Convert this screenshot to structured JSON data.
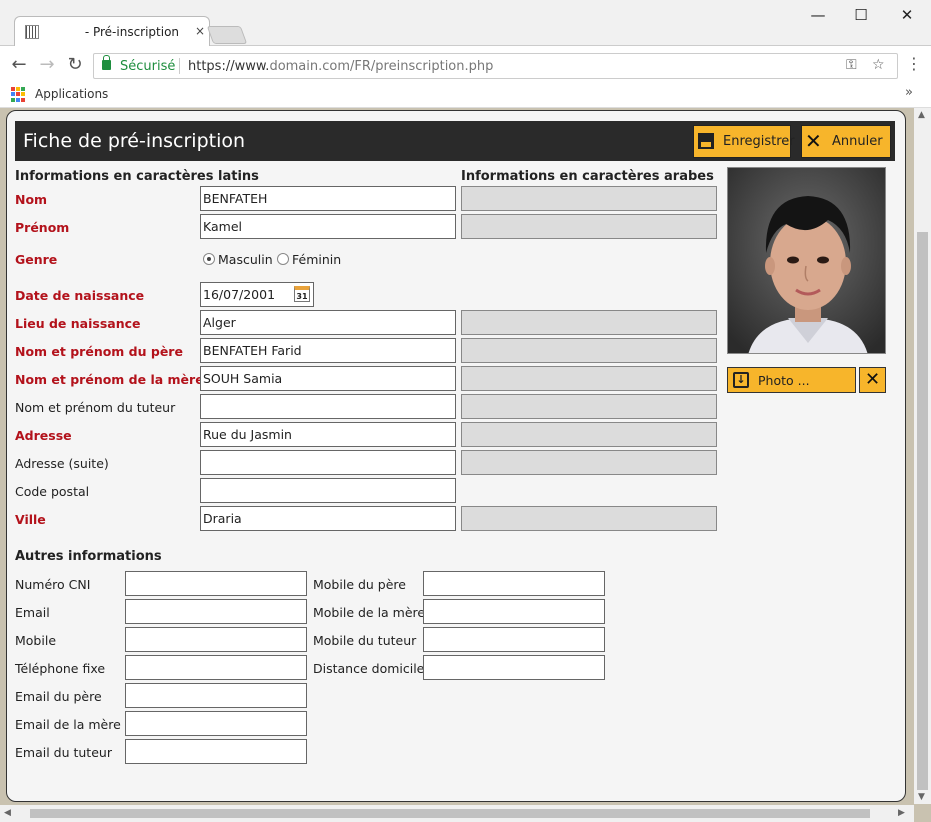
{
  "browser": {
    "tab_title": "Pré-inscription",
    "tab_title_prefix": "    - ",
    "tab_close": "×",
    "win_min": "—",
    "win_max": "☐",
    "win_close": "✕",
    "secure_label": "Sécurisé",
    "url_scheme": "https://www.",
    "url_domain": "domain.com",
    "url_path": "/FR/preinscription.php",
    "bookmark_apps": "Applications",
    "bookmarks_more": "»",
    "icons": [
      "back-icon",
      "forward-icon",
      "reload-icon",
      "lock-icon",
      "key-icon",
      "star-icon",
      "menu-icon",
      "apps-icon"
    ]
  },
  "header": {
    "title": "Fiche de pré-inscription",
    "save_label": "Enregistrer",
    "cancel_label": "Annuler"
  },
  "sections": {
    "latin": "Informations en caractères latins",
    "arabic": "Informations en caractères arabes",
    "other": "Autres informations"
  },
  "fields": {
    "nom": {
      "label": "Nom",
      "value": "BENFATEH"
    },
    "prenom": {
      "label": "Prénom",
      "value": "Kamel"
    },
    "genre": {
      "label": "Genre",
      "options": [
        "Masculin",
        "Féminin"
      ],
      "selected": "Masculin"
    },
    "date_naissance": {
      "label": "Date de naissance",
      "value": "16/07/2001",
      "cal_day": "31"
    },
    "lieu_naissance": {
      "label": "Lieu de naissance",
      "value": "Alger"
    },
    "pere": {
      "label": "Nom et prénom du père",
      "value": "BENFATEH Farid"
    },
    "mere": {
      "label": "Nom et prénom de la mère",
      "value": "SOUH Samia"
    },
    "tuteur": {
      "label": "Nom et prénom du tuteur",
      "value": ""
    },
    "adresse": {
      "label": "Adresse",
      "value": "Rue du Jasmin"
    },
    "adresse_suite": {
      "label": "Adresse (suite)",
      "value": ""
    },
    "code_postal": {
      "label": "Code postal",
      "value": ""
    },
    "ville": {
      "label": "Ville",
      "value": "Draria"
    }
  },
  "photo": {
    "button_label": "Photo ...",
    "delete_label": "✕"
  },
  "other": {
    "left": [
      {
        "label": "Numéro CNI",
        "value": ""
      },
      {
        "label": "Email",
        "value": ""
      },
      {
        "label": "Mobile",
        "value": ""
      },
      {
        "label": "Téléphone fixe",
        "value": ""
      },
      {
        "label": "Email du père",
        "value": ""
      },
      {
        "label": "Email de la mère",
        "value": ""
      },
      {
        "label": "Email du tuteur",
        "value": ""
      }
    ],
    "right": [
      {
        "label": "Mobile du père",
        "value": ""
      },
      {
        "label": "Mobile de la mère",
        "value": ""
      },
      {
        "label": "Mobile du tuteur",
        "value": ""
      },
      {
        "label": "Distance domicile",
        "value": ""
      }
    ]
  },
  "colors": {
    "required_label": "#b3121b",
    "header_bg": "#2a2a2a",
    "button_accent": "#f7b52b",
    "arabic_field_bg": "#dcdcdc",
    "secure_green": "#1e8e3e"
  }
}
